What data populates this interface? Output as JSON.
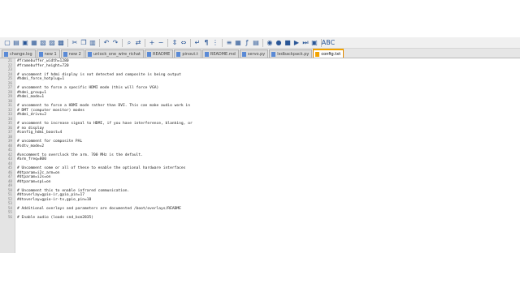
{
  "toolbar": {
    "buttons": [
      {
        "icon": "new-file-icon",
        "glyph": "▢"
      },
      {
        "icon": "open-file-icon",
        "glyph": "▤"
      },
      {
        "icon": "save-icon",
        "glyph": "▣"
      },
      {
        "icon": "save-all-icon",
        "glyph": "▦"
      },
      {
        "icon": "close-icon",
        "glyph": "▧"
      },
      {
        "icon": "close-all-icon",
        "glyph": "▨"
      },
      {
        "icon": "print-icon",
        "glyph": "▩"
      },
      {
        "icon": "cut-icon",
        "glyph": "✂"
      },
      {
        "icon": "copy-icon",
        "glyph": "❐"
      },
      {
        "icon": "paste-icon",
        "glyph": "▥"
      },
      {
        "icon": "undo-icon",
        "glyph": "↶"
      },
      {
        "icon": "redo-icon",
        "glyph": "↷"
      },
      {
        "icon": "find-icon",
        "glyph": "⌕"
      },
      {
        "icon": "replace-icon",
        "glyph": "⇄"
      },
      {
        "icon": "zoom-in-icon",
        "glyph": "+"
      },
      {
        "icon": "zoom-out-icon",
        "glyph": "−"
      },
      {
        "icon": "sync-v-icon",
        "glyph": "⇕"
      },
      {
        "icon": "sync-h-icon",
        "glyph": "⇔"
      },
      {
        "icon": "word-wrap-icon",
        "glyph": "↵"
      },
      {
        "icon": "all-chars-icon",
        "glyph": "¶"
      },
      {
        "icon": "indent-guide-icon",
        "glyph": "⋮"
      },
      {
        "icon": "lang-icon",
        "glyph": "≡"
      },
      {
        "icon": "doc-map-icon",
        "glyph": "▦"
      },
      {
        "icon": "function-list-icon",
        "glyph": "ƒ"
      },
      {
        "icon": "folder-workspace-icon",
        "glyph": "▤"
      },
      {
        "icon": "monitor-icon",
        "glyph": "◉"
      },
      {
        "icon": "record-macro-icon",
        "glyph": "●"
      },
      {
        "icon": "stop-macro-icon",
        "glyph": "■"
      },
      {
        "icon": "play-macro-icon",
        "glyph": "▶"
      },
      {
        "icon": "run-macro-multi-icon",
        "glyph": "⏭"
      },
      {
        "icon": "save-macro-icon",
        "glyph": "▣"
      },
      {
        "icon": "plugin-icon",
        "glyph": "ABC"
      }
    ]
  },
  "tabs": [
    {
      "label": "change.log",
      "active": false
    },
    {
      "label": "new 1",
      "active": false
    },
    {
      "label": "new 2",
      "active": false
    },
    {
      "label": "unlock_one_wire_richat",
      "active": false
    },
    {
      "label": "README",
      "active": false
    },
    {
      "label": "pinout.t",
      "active": false
    },
    {
      "label": "README.md",
      "active": false
    },
    {
      "label": "servo.py",
      "active": false
    },
    {
      "label": "ledbackpack.py",
      "active": false
    },
    {
      "label": "config.txt",
      "active": true
    }
  ],
  "editor": {
    "lines": [
      {
        "num": "21",
        "text": "#framebuffer_width=1280"
      },
      {
        "num": "22",
        "text": "#framebuffer_height=720"
      },
      {
        "num": "23",
        "text": ""
      },
      {
        "num": "24",
        "text": "# uncomment if hdmi display is not detected and composite is being output"
      },
      {
        "num": "25",
        "text": "#hdmi_force_hotplug=1"
      },
      {
        "num": "26",
        "text": ""
      },
      {
        "num": "27",
        "text": "# uncomment to force a specific HDMI mode (this will force VGA)"
      },
      {
        "num": "28",
        "text": "#hdmi_group=1"
      },
      {
        "num": "29",
        "text": "#hdmi_mode=1"
      },
      {
        "num": "30",
        "text": ""
      },
      {
        "num": "31",
        "text": "# uncomment to force a HDMI mode rather than DVI. This can make audio work in"
      },
      {
        "num": "32",
        "text": "# DMT (computer monitor) modes"
      },
      {
        "num": "33",
        "text": "#hdmi_drive=2"
      },
      {
        "num": "34",
        "text": ""
      },
      {
        "num": "35",
        "text": "# uncomment to increase signal to HDMI, if you have interference, blanking, or"
      },
      {
        "num": "36",
        "text": "# no display"
      },
      {
        "num": "37",
        "text": "#config_hdmi_boost=4"
      },
      {
        "num": "38",
        "text": ""
      },
      {
        "num": "39",
        "text": "# uncomment for composite PAL"
      },
      {
        "num": "40",
        "text": "#sdtv_mode=2"
      },
      {
        "num": "41",
        "text": ""
      },
      {
        "num": "42",
        "text": "#uncomment to overclock the arm. 700 MHz is the default."
      },
      {
        "num": "43",
        "text": "#arm_freq=800"
      },
      {
        "num": "44",
        "text": ""
      },
      {
        "num": "45",
        "text": "# Uncomment some or all of these to enable the optional hardware interfaces"
      },
      {
        "num": "46",
        "text": "#dtparam=i2c_arm=on"
      },
      {
        "num": "47",
        "text": "#dtparam=i2s=on"
      },
      {
        "num": "48",
        "text": "#dtparam=spi=on"
      },
      {
        "num": "49",
        "text": ""
      },
      {
        "num": "50",
        "text": "# Uncomment this to enable infrared communication."
      },
      {
        "num": "51",
        "text": "#dtoverlay=gpio-ir,gpio_pin=17"
      },
      {
        "num": "52",
        "text": "#dtoverlay=gpio-ir-tx,gpio_pin=18"
      },
      {
        "num": "53",
        "text": ""
      },
      {
        "num": "54",
        "text": "# Additional overlays and parameters are documented /boot/overlays/README"
      },
      {
        "num": "55",
        "text": ""
      },
      {
        "num": "56",
        "text": "# Enable audio (loads snd_bcm2835)"
      }
    ]
  },
  "colors": {
    "active_tab_accent": "#f2a300",
    "gutter": "#e4e4e4",
    "toolbar": "#f0f0f0"
  }
}
